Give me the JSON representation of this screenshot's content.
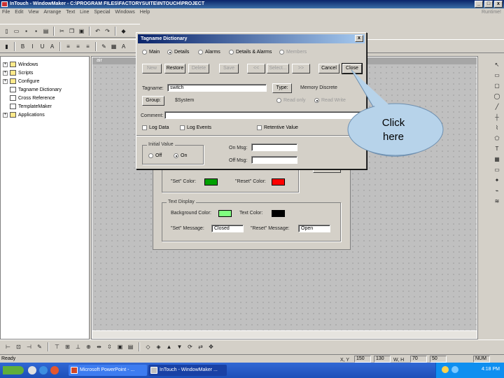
{
  "app": {
    "title": "InTouch - WindowMaker - C:\\PROGRAM FILES\\FACTORYSUITE\\INTOUCH\\PROJECT"
  },
  "window_buttons": {
    "minimize": "_",
    "maximize": "□",
    "close": "x"
  },
  "menu": {
    "items": [
      "File",
      "Edit",
      "View",
      "Arrange",
      "Text",
      "Line",
      "Special",
      "Windows",
      "Help"
    ],
    "right_label": "Runtime!"
  },
  "tree": {
    "items": [
      {
        "label": "Windows",
        "icon": "folder-icon"
      },
      {
        "label": "Scripts",
        "icon": "folder-icon"
      },
      {
        "label": "Configure",
        "icon": "folder-icon"
      },
      {
        "label": "Tagname Dictionary",
        "icon": "dictionary-icon"
      },
      {
        "label": "Cross Reference",
        "icon": "cross-reference-icon"
      },
      {
        "label": "TemplateMaker",
        "icon": "template-icon"
      },
      {
        "label": "Applications",
        "icon": "folder-icon"
      }
    ]
  },
  "canvas_window": {
    "title": "air"
  },
  "dialog": {
    "title": "Tagname Dictionary",
    "close": "x",
    "view_options": [
      {
        "label": "Main",
        "selected": false,
        "enabled": true
      },
      {
        "label": "Details",
        "selected": true,
        "enabled": true
      },
      {
        "label": "Alarms",
        "selected": false,
        "enabled": true
      },
      {
        "label": "Details & Alarms",
        "selected": false,
        "enabled": true
      },
      {
        "label": "Members",
        "selected": false,
        "enabled": false
      }
    ],
    "buttons": {
      "new": "New",
      "restore": "Restore",
      "delete": "Delete",
      "save": "Save",
      "prev": "<<",
      "select": "Select...",
      "next": ">>",
      "cancel": "Cancel",
      "close": "Close"
    },
    "tagname_label": "Tagname:",
    "tagname_value": "switch",
    "type_button": "Type:",
    "type_value": "Memory Discrete",
    "group_button": "Group:",
    "group_value": "$System",
    "read_only": "Read only",
    "read_write": "Read Write",
    "access_selected": "Read Write",
    "comment_label": "Comment:",
    "comment_value": "",
    "log_data": "Log Data",
    "log_events": "Log Events",
    "retentive": "Retentive Value",
    "initial_value": {
      "label": "Initial Value",
      "off": "Off",
      "on": "On",
      "selected": "On"
    },
    "on_msg_label": "On Msg:",
    "off_msg_label": "Off Msg:",
    "on_msg_value": "",
    "off_msg_value": ""
  },
  "background_window": {
    "set_color_label": "\"Set\" Color:",
    "reset_color_label": "\"Reset\" Color:",
    "set_color": "#00a000",
    "reset_color": "#ff0000",
    "text_display_label": "Text Display",
    "background_color_label": "Background Color:",
    "text_color_label": "Text Color:",
    "background_color": "#80ff80",
    "text_color": "#000000",
    "set_message_label": "\"Set\" Message:",
    "set_message_value": "Closed",
    "reset_message_label": "\"Reset\" Message:",
    "reset_message_value": "Open"
  },
  "callout": {
    "text": "Click here",
    "fill": "#b7d3ea"
  },
  "status": {
    "left": "Ready",
    "xy_label": "X, Y",
    "x": "150",
    "y": "130",
    "wh_label": "W, H",
    "w": "70",
    "h": "50",
    "num": "NUM"
  },
  "taskbar": {
    "tasks": [
      {
        "label": "Microsoft PowerPoint - ...",
        "icon_color": "#d24726"
      },
      {
        "label": "InTouch - WindowMaker ...",
        "icon_color": "#c0c0c0"
      }
    ],
    "tray_text": "N",
    "clock": "4:18 PM"
  }
}
